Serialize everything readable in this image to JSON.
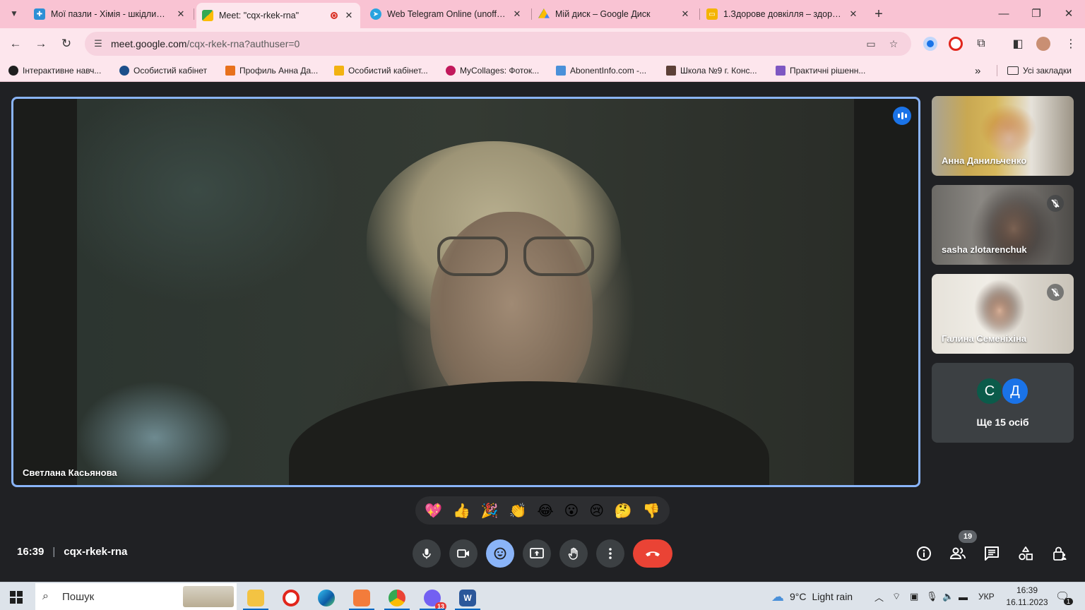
{
  "browser": {
    "tabs": [
      {
        "title": "Мої пазли - Хімія - шкідливі ...",
        "active": false
      },
      {
        "title": "Meet: \"cqx-rkek-rna\"",
        "active": true
      },
      {
        "title": "Web Telegram Online (unofficial)",
        "active": false
      },
      {
        "title": "Мій диск – Google Диск",
        "active": false
      },
      {
        "title": "1.Здорове довкілля – здорова ...",
        "active": false
      }
    ],
    "close_glyph": "✕",
    "new_tab_glyph": "+",
    "window_controls": {
      "minimize": "—",
      "restore": "❐",
      "close": "✕"
    },
    "url_host": "meet.google.com",
    "url_path": "/cqx-rkek-rna?authuser=0",
    "bookmarks": [
      {
        "label": "Інтерактивне навч...",
        "color": "#1f1f1f"
      },
      {
        "label": "Особистий кабінет",
        "color": "#1c4e8a"
      },
      {
        "label": "Профиль Анна Да...",
        "color": "#e8711c"
      },
      {
        "label": "Особистий кабінет...",
        "color": "#f2b211"
      },
      {
        "label": "MyCollages: Фоток...",
        "color": "#c2185b"
      },
      {
        "label": "AbonentInfo.com -...",
        "color": "#4a90d9"
      },
      {
        "label": "Школа №9 г. Конс...",
        "color": "#5d4037"
      },
      {
        "label": "Практичні рішенн...",
        "color": "#7e57c2"
      }
    ],
    "bookmarks_overflow": "»",
    "all_bookmarks_label": "Усі закладки"
  },
  "meet": {
    "main_speaker": "Светлана Касьянова",
    "participants": [
      {
        "name": "Анна Данильченко",
        "muted": false
      },
      {
        "name": "sasha zlotarenchuk",
        "muted": true
      },
      {
        "name": "Галина Семеніхіна",
        "muted": true
      }
    ],
    "more_avatars": [
      {
        "letter": "С",
        "color": "#0b5b4a"
      },
      {
        "letter": "Д",
        "color": "#1a73e8"
      }
    ],
    "more_label": "Ще 15 осіб",
    "reactions": [
      "💖",
      "👍",
      "🎉",
      "👏",
      "😂",
      "😮",
      "😢",
      "🤔",
      "👎"
    ],
    "time": "16:39",
    "meeting_code": "cqx-rkek-rna",
    "people_count": "19"
  },
  "taskbar": {
    "search_placeholder": "Пошук",
    "weather_temp": "9°C",
    "weather_desc": "Light rain",
    "language": "УКР",
    "time": "16:39",
    "date": "16.11.2023",
    "notification_count": "1",
    "viber_badge": "13"
  }
}
